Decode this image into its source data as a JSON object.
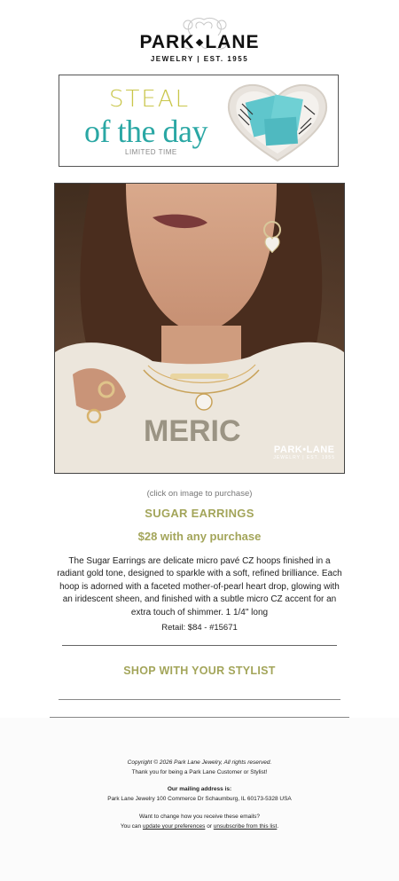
{
  "brand": {
    "wordmark_left": "PARK",
    "wordmark_right": "LANE",
    "subtitle": "JEWELRY | EST. 1955"
  },
  "banner": {
    "line1": "STEAL",
    "line2": "of the day",
    "line3": "LIMITED TIME"
  },
  "photo": {
    "watermark_main": "PARK•LANE",
    "watermark_sub": "JEWELRY | EST. 1955",
    "shirt_text": "MERIC"
  },
  "product": {
    "click_hint": "(click on image to purchase)",
    "name": "SUGAR EARRINGS",
    "price_line": "$28 with any purchase",
    "description": "The Sugar Earrings are delicate micro pavé CZ hoops finished in a radiant gold tone, designed to sparkle with a soft, refined brilliance. Each hoop is adorned with a faceted mother-of-pearl heart drop, glowing with an iridescent sheen, and finished with a subtle micro CZ accent for an extra touch of shimmer. 1 1/4\"   long",
    "retail": "Retail: $84 - #15671"
  },
  "cta": {
    "shop_label": "SHOP WITH YOUR STYLIST"
  },
  "footer": {
    "copyright": "Copyright © 2026 Park Lane Jewelry, All rights reserved.",
    "thanks": "Thank you for being a Park Lane Customer or Stylist!",
    "mailing_heading": "Our mailing address is:",
    "address": "Park Lane Jewelry 100 Commerce Dr Schaumburg, IL 60173-5328 USA",
    "change_prompt": "Want to change how you receive these emails?",
    "you_can": "You can",
    "update_link": "update your preferences",
    "or": "or",
    "unsubscribe_link": "unsubscribe from this list",
    "period": "."
  },
  "colors": {
    "accent_olive": "#a3a55a",
    "accent_teal": "#2aa7a4",
    "accent_yellow": "#c9c64a"
  }
}
